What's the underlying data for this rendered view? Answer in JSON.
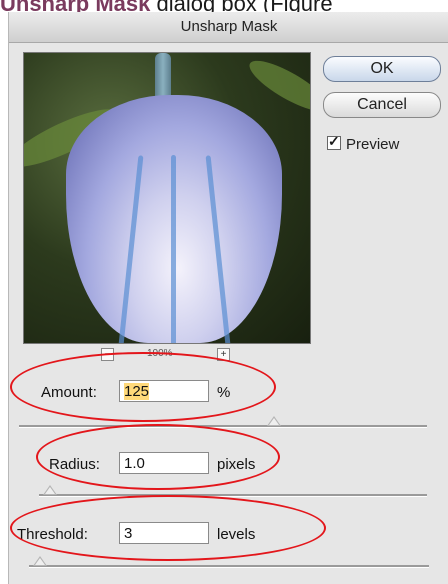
{
  "caption": {
    "highlight": "Unsharp Mask",
    "rest": " dialog box (Figure"
  },
  "dialog": {
    "title": "Unsharp Mask"
  },
  "preview_image": {
    "description": "bluebell flower close-up"
  },
  "zoom": {
    "minus": "−",
    "level": "100%",
    "plus": "+"
  },
  "buttons": {
    "ok": "OK",
    "cancel": "Cancel"
  },
  "preview_checkbox": {
    "label": "Preview",
    "checked": true
  },
  "amount": {
    "label": "Amount:",
    "value": "125",
    "unit": "%",
    "slider_fraction": 0.5
  },
  "radius": {
    "label": "Radius:",
    "value": "1.0",
    "unit": "pixels",
    "slider_fraction": 0.05
  },
  "threshold": {
    "label": "Threshold:",
    "value": "3",
    "unit": "levels",
    "slider_fraction": 0.01
  },
  "colors": {
    "annotation_ellipse": "#e3161b",
    "ok_button_tint": "#c9d7ea",
    "highlighted_value_bg": "#ffd97a"
  }
}
